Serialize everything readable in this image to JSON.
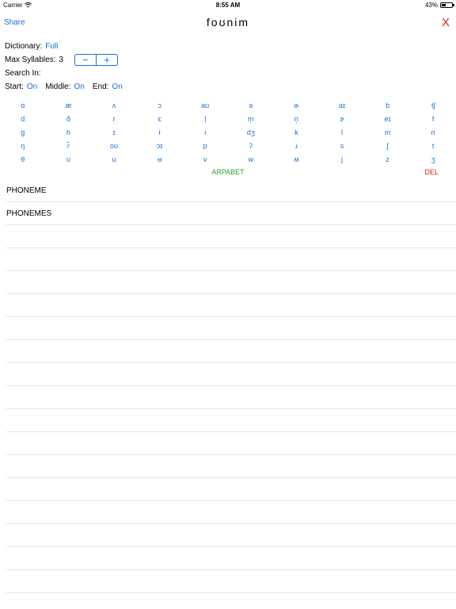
{
  "status_bar": {
    "carrier": "Carrier",
    "time": "8:55 AM",
    "battery_text": "43%",
    "battery_level": 0.43
  },
  "nav": {
    "share_label": "Share",
    "title": "foʊnim",
    "close_label": "X"
  },
  "settings": {
    "dictionary_label": "Dictionary:",
    "dictionary_value": "Full",
    "max_syllables_label": "Max Syllables:",
    "max_syllables_value": "3",
    "stepper_minus": "−",
    "stepper_plus": "+",
    "search_in_label": "Search In:",
    "start_label": "Start:",
    "start_value": "On",
    "middle_label": "Middle:",
    "middle_value": "On",
    "end_label": "End:",
    "end_value": "On"
  },
  "keyboard": {
    "rows": [
      [
        "ɑ",
        "æ",
        "ʌ",
        "ɔ",
        "aʊ",
        "ə",
        "ɚ",
        "aɪ",
        "b",
        "tʃ"
      ],
      [
        "d",
        "ð",
        "ɾ",
        "ɛ",
        "l̩",
        "m̩",
        "n̩",
        "ɝ",
        "eɪ",
        "f"
      ],
      [
        "g",
        "h",
        "ɪ",
        "ɨ",
        "i",
        "dʒ",
        "k",
        "l",
        "m",
        "n"
      ],
      [
        "ŋ",
        "ɾ̃",
        "oʊ",
        "ɔɪ",
        "p",
        "ʔ",
        "ɹ",
        "s",
        "ʃ",
        "t"
      ],
      [
        "θ",
        "ʊ",
        "u",
        "ʉ",
        "v",
        "w",
        "ʍ",
        "j",
        "z",
        "ʒ"
      ]
    ],
    "arpabet_label": "ARPABET",
    "del_label": "DEL"
  },
  "results": [
    "PHONEME",
    "PHONEMES",
    "",
    "",
    "",
    "",
    "",
    "",
    "",
    "",
    "",
    "",
    "",
    "",
    "",
    "",
    "",
    ""
  ],
  "colors": {
    "accent_blue": "#1a6fd6",
    "close_red": "#e0201b",
    "arpabet_green": "#2aa52a",
    "separator": "#e6e6e6"
  }
}
